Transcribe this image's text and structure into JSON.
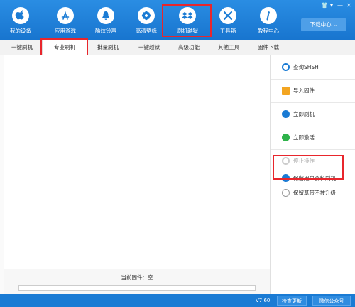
{
  "nav": {
    "items": [
      {
        "label": "我的设备",
        "icon": "apple-icon"
      },
      {
        "label": "应用游戏",
        "icon": "app-store-icon"
      },
      {
        "label": "酷炫铃声",
        "icon": "bell-icon"
      },
      {
        "label": "高清壁纸",
        "icon": "flower-icon"
      },
      {
        "label": "刷机越狱",
        "icon": "dropbox-box-icon"
      },
      {
        "label": "工具箱",
        "icon": "tools-icon"
      },
      {
        "label": "教程中心",
        "icon": "info-icon"
      }
    ],
    "download_center": "下载中心",
    "window_controls": [
      "shirt",
      "menu",
      "minimize",
      "close"
    ]
  },
  "tabs": [
    "一键刷机",
    "专业刷机",
    "批量刷机",
    "一键越狱",
    "高级功能",
    "其他工具",
    "固件下载"
  ],
  "actions": {
    "query_shsh": "查询SHSH",
    "import_firmware": "导入固件",
    "flash_now": "立即刷机",
    "activate_now": "立即激活",
    "stop": "停止操作",
    "keep_data": "保留用户资料刷机",
    "anti_upgrade": "保留基带不被升级"
  },
  "firmware": {
    "current_label": "当前固件：空"
  },
  "status": {
    "version": "V7.60",
    "check_update": "检查更新",
    "wechat": "微信公众号"
  },
  "colors": {
    "brand": "#1a7bd4",
    "highlight": "#e8262c"
  }
}
